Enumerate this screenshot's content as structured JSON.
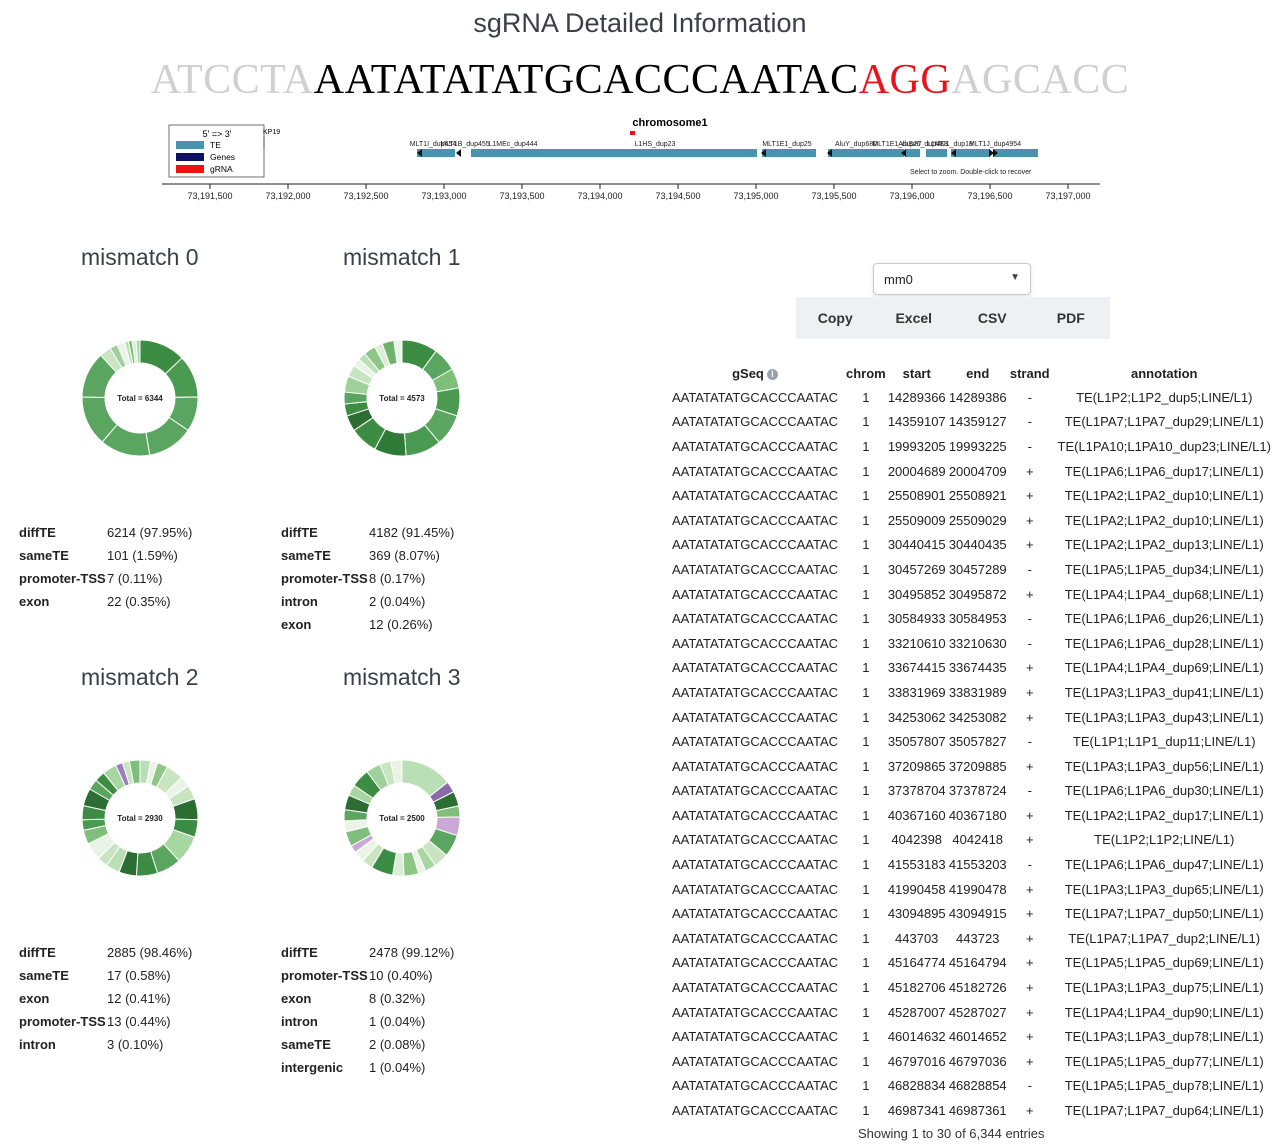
{
  "page_title": "sgRNA Detailed Information",
  "sequence": {
    "left_flank": "ATCCTA",
    "core": "AATATATATGCACCCAATAC",
    "pam": "AGG",
    "right_flank": "AGCACC"
  },
  "genome_track": {
    "chromosome_label": "chromosome1",
    "hint": "Select to zoom. Double-click to recover",
    "legend_title": "5' => 3'",
    "legend": [
      {
        "label": "TE",
        "color": "#4a93ad"
      },
      {
        "label": "Genes",
        "color": "#0b1160"
      },
      {
        "label": "gRNA",
        "color": "#ee1111"
      }
    ],
    "gene_fragment": "KP19",
    "feature_labels": [
      "MLT1I_dup454",
      "MLT1B_dup455",
      "L1MEc_dup444",
      "L1HS_dup23",
      "MLT1E1_dup25",
      "AluY_dup680",
      "MLT1E1_dup27",
      "AluSz6_dup483",
      "L1MD1_dup18",
      "MLT1J_dup4954"
    ],
    "axis_ticks": [
      "73,191,500",
      "73,192,000",
      "73,192,500",
      "73,193,000",
      "73,193,500",
      "73,194,000",
      "73,194,500",
      "73,195,000",
      "73,195,500",
      "73,196,000",
      "73,196,500",
      "73,197,000"
    ]
  },
  "mismatch_panels": [
    {
      "title": "mismatch 0",
      "total_label": "Total = 6344",
      "stats": [
        {
          "key": "diffTE",
          "value": "6214 (97.95%)"
        },
        {
          "key": "sameTE",
          "value": "101 (1.59%)"
        },
        {
          "key": "promoter-TSS",
          "value": "7 (0.11%)"
        },
        {
          "key": "exon",
          "value": "22 (0.35%)"
        }
      ]
    },
    {
      "title": "mismatch 1",
      "total_label": "Total = 4573",
      "stats": [
        {
          "key": "diffTE",
          "value": "4182 (91.45%)"
        },
        {
          "key": "sameTE",
          "value": "369 (8.07%)"
        },
        {
          "key": "promoter-TSS",
          "value": "8 (0.17%)"
        },
        {
          "key": "intron",
          "value": "2 (0.04%)"
        },
        {
          "key": "exon",
          "value": "12 (0.26%)"
        }
      ]
    },
    {
      "title": "mismatch 2",
      "total_label": "Total = 2930",
      "stats": [
        {
          "key": "diffTE",
          "value": "2885 (98.46%)"
        },
        {
          "key": "sameTE",
          "value": "17 (0.58%)"
        },
        {
          "key": "exon",
          "value": "12 (0.41%)"
        },
        {
          "key": "promoter-TSS",
          "value": "13 (0.44%)"
        },
        {
          "key": "intron",
          "value": "3 (0.10%)"
        }
      ]
    },
    {
      "title": "mismatch 3",
      "total_label": "Total = 2500",
      "stats": [
        {
          "key": "diffTE",
          "value": "2478 (99.12%)"
        },
        {
          "key": "promoter-TSS",
          "value": "10 (0.40%)"
        },
        {
          "key": "exon",
          "value": "8 (0.32%)"
        },
        {
          "key": "intron",
          "value": "1 (0.04%)"
        },
        {
          "key": "sameTE",
          "value": "2 (0.08%)"
        },
        {
          "key": "intergenic",
          "value": "1 (0.04%)"
        }
      ]
    }
  ],
  "mismatch_select": {
    "value": "mm0"
  },
  "export_buttons": [
    "Copy",
    "Excel",
    "CSV",
    "PDF"
  ],
  "table": {
    "headers": [
      "gSeq",
      "chrom",
      "start",
      "end",
      "strand",
      "annotation"
    ],
    "rows": [
      [
        "AATATATATGCACCCAATAC",
        "1",
        "14289366",
        "14289386",
        "-",
        "TE(L1P2;L1P2_dup5;LINE/L1)"
      ],
      [
        "AATATATATGCACCCAATAC",
        "1",
        "14359107",
        "14359127",
        "-",
        "TE(L1PA7;L1PA7_dup29;LINE/L1)"
      ],
      [
        "AATATATATGCACCCAATAC",
        "1",
        "19993205",
        "19993225",
        "-",
        "TE(L1PA10;L1PA10_dup23;LINE/L1)"
      ],
      [
        "AATATATATGCACCCAATAC",
        "1",
        "20004689",
        "20004709",
        "+",
        "TE(L1PA6;L1PA6_dup17;LINE/L1)"
      ],
      [
        "AATATATATGCACCCAATAC",
        "1",
        "25508901",
        "25508921",
        "+",
        "TE(L1PA2;L1PA2_dup10;LINE/L1)"
      ],
      [
        "AATATATATGCACCCAATAC",
        "1",
        "25509009",
        "25509029",
        "+",
        "TE(L1PA2;L1PA2_dup10;LINE/L1)"
      ],
      [
        "AATATATATGCACCCAATAC",
        "1",
        "30440415",
        "30440435",
        "+",
        "TE(L1PA2;L1PA2_dup13;LINE/L1)"
      ],
      [
        "AATATATATGCACCCAATAC",
        "1",
        "30457269",
        "30457289",
        "-",
        "TE(L1PA5;L1PA5_dup34;LINE/L1)"
      ],
      [
        "AATATATATGCACCCAATAC",
        "1",
        "30495852",
        "30495872",
        "+",
        "TE(L1PA4;L1PA4_dup68;LINE/L1)"
      ],
      [
        "AATATATATGCACCCAATAC",
        "1",
        "30584933",
        "30584953",
        "-",
        "TE(L1PA6;L1PA6_dup26;LINE/L1)"
      ],
      [
        "AATATATATGCACCCAATAC",
        "1",
        "33210610",
        "33210630",
        "-",
        "TE(L1PA6;L1PA6_dup28;LINE/L1)"
      ],
      [
        "AATATATATGCACCCAATAC",
        "1",
        "33674415",
        "33674435",
        "+",
        "TE(L1PA4;L1PA4_dup69;LINE/L1)"
      ],
      [
        "AATATATATGCACCCAATAC",
        "1",
        "33831969",
        "33831989",
        "+",
        "TE(L1PA3;L1PA3_dup41;LINE/L1)"
      ],
      [
        "AATATATATGCACCCAATAC",
        "1",
        "34253062",
        "34253082",
        "+",
        "TE(L1PA3;L1PA3_dup43;LINE/L1)"
      ],
      [
        "AATATATATGCACCCAATAC",
        "1",
        "35057807",
        "35057827",
        "-",
        "TE(L1P1;L1P1_dup11;LINE/L1)"
      ],
      [
        "AATATATATGCACCCAATAC",
        "1",
        "37209865",
        "37209885",
        "+",
        "TE(L1PA3;L1PA3_dup56;LINE/L1)"
      ],
      [
        "AATATATATGCACCCAATAC",
        "1",
        "37378704",
        "37378724",
        "-",
        "TE(L1PA6;L1PA6_dup30;LINE/L1)"
      ],
      [
        "AATATATATGCACCCAATAC",
        "1",
        "40367160",
        "40367180",
        "+",
        "TE(L1PA2;L1PA2_dup17;LINE/L1)"
      ],
      [
        "AATATATATGCACCCAATAC",
        "1",
        "4042398",
        "4042418",
        "+",
        "TE(L1P2;L1P2;LINE/L1)"
      ],
      [
        "AATATATATGCACCCAATAC",
        "1",
        "41553183",
        "41553203",
        "-",
        "TE(L1PA6;L1PA6_dup47;LINE/L1)"
      ],
      [
        "AATATATATGCACCCAATAC",
        "1",
        "41990458",
        "41990478",
        "+",
        "TE(L1PA3;L1PA3_dup65;LINE/L1)"
      ],
      [
        "AATATATATGCACCCAATAC",
        "1",
        "43094895",
        "43094915",
        "+",
        "TE(L1PA7;L1PA7_dup50;LINE/L1)"
      ],
      [
        "AATATATATGCACCCAATAC",
        "1",
        "443703",
        "443723",
        "+",
        "TE(L1PA7;L1PA7_dup2;LINE/L1)"
      ],
      [
        "AATATATATGCACCCAATAC",
        "1",
        "45164774",
        "45164794",
        "+",
        "TE(L1PA5;L1PA5_dup69;LINE/L1)"
      ],
      [
        "AATATATATGCACCCAATAC",
        "1",
        "45182706",
        "45182726",
        "+",
        "TE(L1PA3;L1PA3_dup75;LINE/L1)"
      ],
      [
        "AATATATATGCACCCAATAC",
        "1",
        "45287007",
        "45287027",
        "+",
        "TE(L1PA4;L1PA4_dup90;LINE/L1)"
      ],
      [
        "AATATATATGCACCCAATAC",
        "1",
        "46014632",
        "46014652",
        "+",
        "TE(L1PA3;L1PA3_dup78;LINE/L1)"
      ],
      [
        "AATATATATGCACCCAATAC",
        "1",
        "46797016",
        "46797036",
        "+",
        "TE(L1PA5;L1PA5_dup77;LINE/L1)"
      ],
      [
        "AATATATATGCACCCAATAC",
        "1",
        "46828834",
        "46828854",
        "-",
        "TE(L1PA5;L1PA5_dup78;LINE/L1)"
      ],
      [
        "AATATATATGCACCCAATAC",
        "1",
        "46987341",
        "46987361",
        "+",
        "TE(L1PA7;L1PA7_dup64;LINE/L1)"
      ]
    ],
    "footer": "Showing 1 to 30 of 6,344 entries"
  }
}
